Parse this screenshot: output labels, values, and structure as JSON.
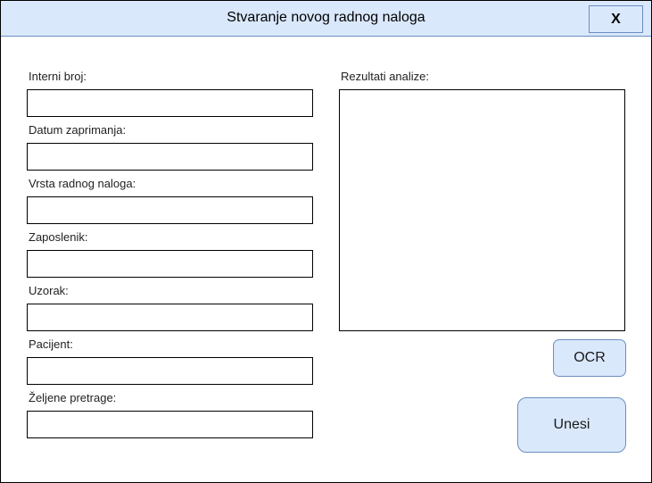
{
  "window": {
    "title": "Stvaranje novog radnog naloga",
    "close_label": "X"
  },
  "form": {
    "fields": [
      {
        "label": "Interni broj:",
        "value": ""
      },
      {
        "label": "Datum zaprimanja:",
        "value": ""
      },
      {
        "label": "Vrsta radnog naloga:",
        "value": ""
      },
      {
        "label": "Zaposlenik:",
        "value": ""
      },
      {
        "label": "Uzorak:",
        "value": ""
      },
      {
        "label": "Pacijent:",
        "value": ""
      },
      {
        "label": "Željene pretrage:",
        "value": ""
      }
    ]
  },
  "results": {
    "label": "Rezultati analize:",
    "value": ""
  },
  "buttons": {
    "ocr_label": "OCR",
    "submit_label": "Unesi"
  },
  "colors": {
    "accent_fill": "#dae8fc",
    "accent_border": "#6c8ebf"
  }
}
